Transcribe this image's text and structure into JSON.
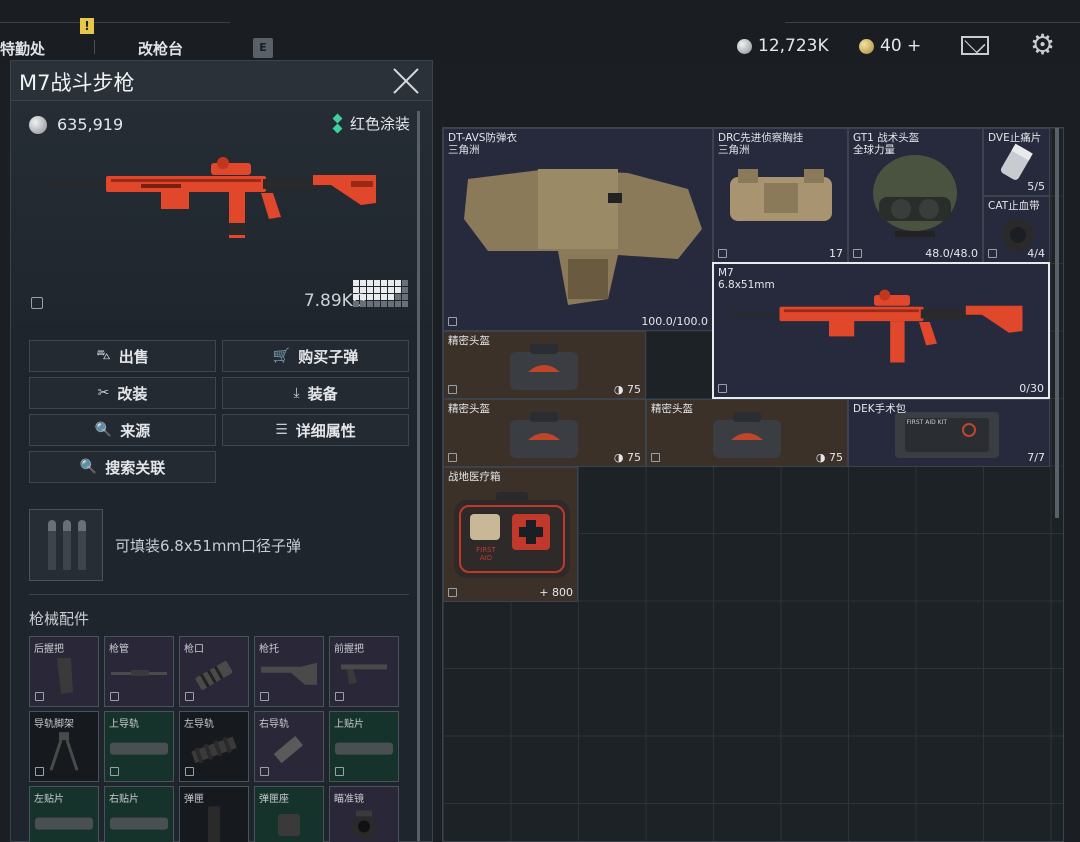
{
  "top_bar": {
    "tab_left": "特勤处",
    "tab_right": "改枪台",
    "key_hint": "E",
    "warning_mark": "!",
    "currency_silver": "12,723K",
    "currency_gold": "40 +",
    "icons": [
      "silver-coin-icon",
      "gold-coin-icon",
      "mail-icon",
      "gear-icon"
    ]
  },
  "item_panel": {
    "title": "M7战斗步枪",
    "price": "635,919",
    "skin": "红色涂装",
    "weight": "7.89KG",
    "actions": [
      {
        "label": "出售",
        "icon": "⛍"
      },
      {
        "label": "购买子弹",
        "icon": "🛒"
      },
      {
        "label": "改装",
        "icon": "✂"
      },
      {
        "label": "装备",
        "icon": "⤓"
      },
      {
        "label": "来源",
        "icon": "🔍"
      },
      {
        "label": "详细属性",
        "icon": "☰"
      },
      {
        "label": "搜索关联",
        "icon": "🔍"
      }
    ],
    "ammo_text": "可填装6.8x51mm口径子弹",
    "attachments_title": "枪械配件",
    "attachments": [
      {
        "label": "后握把",
        "style": "purple"
      },
      {
        "label": "枪管",
        "style": "purple"
      },
      {
        "label": "枪口",
        "style": "purple"
      },
      {
        "label": "枪托",
        "style": "purple"
      },
      {
        "label": "前握把",
        "style": "purple"
      },
      {
        "label": "导轨脚架",
        "style": "dark"
      },
      {
        "label": "上导轨",
        "style": "green"
      },
      {
        "label": "左导轨",
        "style": "dark"
      },
      {
        "label": "右导轨",
        "style": "purple"
      },
      {
        "label": "上贴片",
        "style": "green"
      },
      {
        "label": "左贴片",
        "style": "green"
      },
      {
        "label": "右贴片",
        "style": "green"
      },
      {
        "label": "弹匣",
        "style": "dark"
      },
      {
        "label": "弹匣座",
        "style": "green"
      },
      {
        "label": "瞄准镜",
        "style": "purple"
      }
    ]
  },
  "inventory": {
    "items": [
      {
        "id": "vest",
        "name": "DT-AVS防弹衣",
        "sub": "三角洲",
        "count": "100.0/100.0"
      },
      {
        "id": "rig",
        "name": "DRC先进侦察胸挂",
        "sub": "三角洲",
        "count": "17"
      },
      {
        "id": "helmet",
        "name": "GT1 战术头盔",
        "sub": "全球力量",
        "count": "48.0/48.0"
      },
      {
        "id": "dve",
        "name": "DVE止痛片",
        "sub": "",
        "count": "5/5"
      },
      {
        "id": "cat",
        "name": "CAT止血带",
        "sub": "",
        "count": "4/4"
      },
      {
        "id": "m7",
        "name": "M7",
        "sub": "6.8x51mm",
        "count": "0/30"
      },
      {
        "id": "hb1",
        "name": "精密头盔",
        "sub": "",
        "count": "75"
      },
      {
        "id": "hb2",
        "name": "精密头盔",
        "sub": "",
        "count": "75"
      },
      {
        "id": "hb3",
        "name": "精密头盔",
        "sub": "",
        "count": "75"
      },
      {
        "id": "dek",
        "name": "DEK手术包",
        "sub": "",
        "count": "7/7"
      },
      {
        "id": "medbox",
        "name": "战地医疗箱",
        "sub": "",
        "count": "+ 800"
      }
    ],
    "medbox_print_1": "FIRST",
    "medbox_print_2": "AID",
    "dek_print": "FIRST AID KIT"
  },
  "colors": {
    "gun_red": "#e0472b",
    "skin_green": "#3ed19c",
    "selection": "#e8eaec"
  }
}
